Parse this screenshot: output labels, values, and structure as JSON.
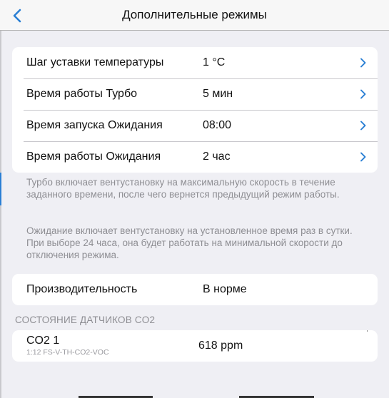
{
  "header": {
    "title": "Дополнительные режимы",
    "back_icon": "chevron-left-icon"
  },
  "settings": {
    "rows": [
      {
        "label": "Шаг уставки температуры",
        "value": "1 °C"
      },
      {
        "label": "Время работы Турбо",
        "value": "5 мин"
      },
      {
        "label": "Время запуска Ожидания",
        "value": "08:00"
      },
      {
        "label": "Время работы Ожидания",
        "value": "2 час"
      }
    ]
  },
  "notes": {
    "turbo": "Турбо включает вентустановку на максимальную скорость в течение заданного времени, после чего вернется предыдущий режим работы.",
    "standby": "Ожидание включает вентустановку на установленное время раз в сутки. При выборе 24 часа, она будет работать на минимальной скорости до отключения режима."
  },
  "performance": {
    "label": "Производительность",
    "value": "В норме"
  },
  "sensors": {
    "header": "СОСТОЯНИЕ ДАТЧИКОВ CO2",
    "items": [
      {
        "name": "CO2 1",
        "sub": "1:12 FS-V-TH-CO2-VOC",
        "value": "618 ppm"
      }
    ]
  },
  "colors": {
    "accent": "#2a7fd4",
    "background": "#efeff4",
    "secondary_text": "#8e8e93"
  }
}
